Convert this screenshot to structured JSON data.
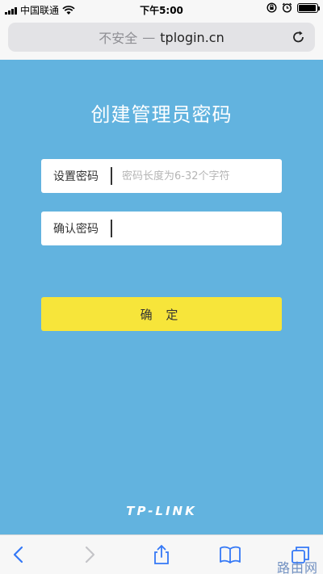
{
  "status_bar": {
    "carrier": "中国联通",
    "time": "下午5:00",
    "battery_level": 0.95
  },
  "address_bar": {
    "insecure_label": "不安全",
    "separator": "—",
    "host": "tplogin.cn"
  },
  "page": {
    "title": "创建管理员密码",
    "password_field": {
      "label": "设置密码",
      "placeholder": "密码长度为6-32个字符",
      "value": ""
    },
    "confirm_field": {
      "label": "确认密码",
      "placeholder": "",
      "value": ""
    },
    "submit_label": "确 定",
    "brand": "TP-LINK"
  },
  "watermark": "路由网",
  "colors": {
    "background": "#62b3df",
    "button": "#f7e53a",
    "ios_blue": "#3478f6"
  },
  "icons": [
    "signal-icon",
    "wifi-icon",
    "lock-rotation-icon",
    "alarm-icon",
    "battery-icon",
    "reload-icon",
    "back-icon",
    "forward-icon",
    "share-icon",
    "bookmarks-icon",
    "tabs-icon"
  ]
}
